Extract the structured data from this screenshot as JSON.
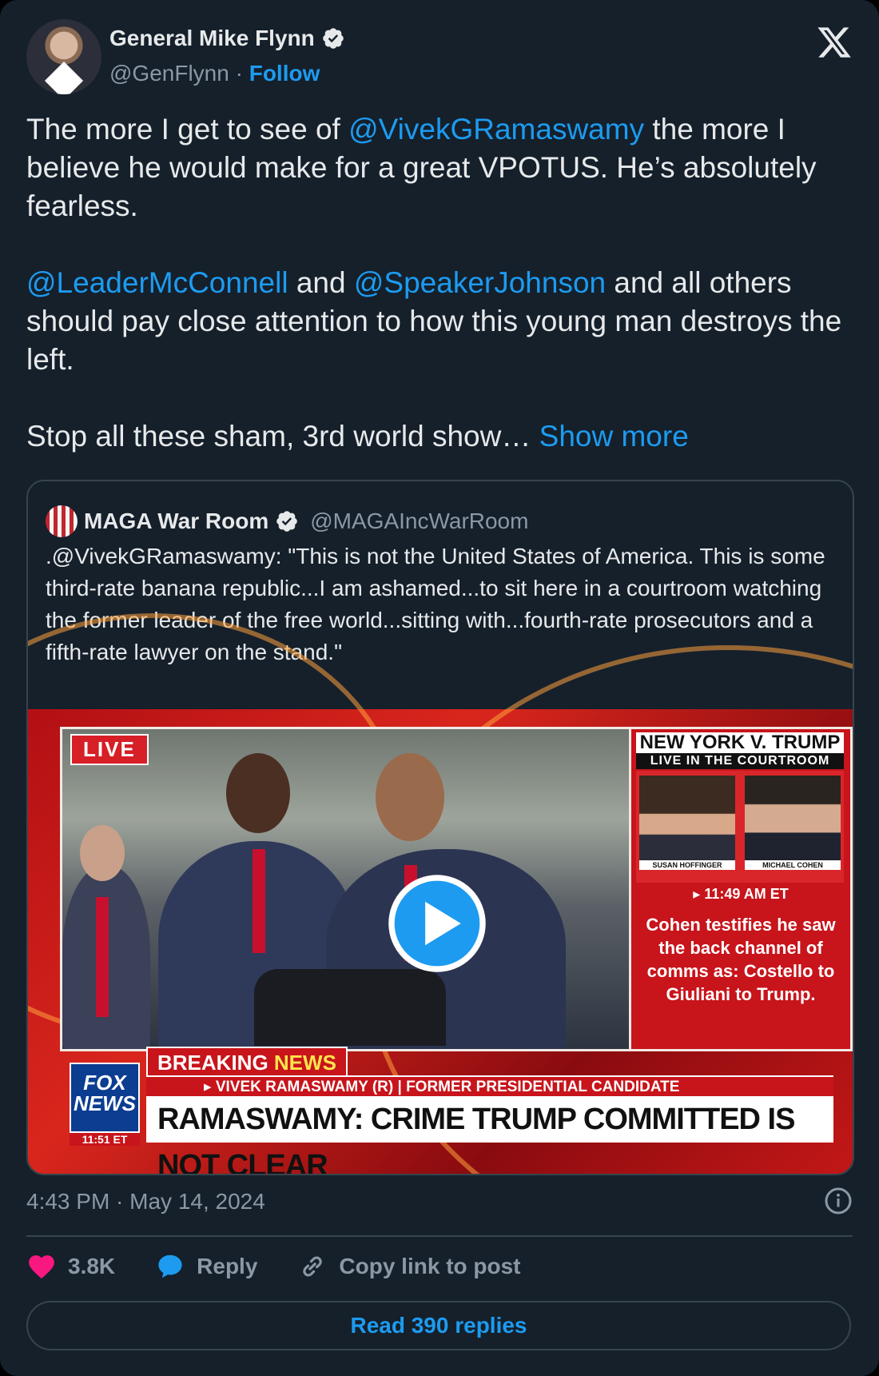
{
  "author": {
    "display_name": "General Mike Flynn",
    "handle": "@GenFlynn",
    "separator": "·",
    "follow_label": "Follow"
  },
  "tweet": {
    "part1": "The more I get to see of ",
    "mention1": "@VivekGRamaswamy",
    "part2": " the more I believe he would make for a great VPOTUS. He’s absolutely fearless.\n\n",
    "mention2": "@LeaderMcConnell",
    "part3": " and ",
    "mention3": "@SpeakerJohnson",
    "part4": " and all others should pay close attention to how this young man destroys the left.\n\nStop all these sham, 3rd world show… ",
    "show_more": "Show more"
  },
  "quote": {
    "display_name": "MAGA War Room",
    "handle": "@MAGAIncWarRoom",
    "text": ".@VivekGRamaswamy: \"This is not the United States of America. This is some third-rate banana republic...I am ashamed...to sit here in a courtroom watching the former leader of the free world...sitting with...fourth-rate prosecutors and a fifth-rate lawyer on the stand.\""
  },
  "video": {
    "live_tag": "LIVE",
    "side_title": "NEW YORK V. TRUMP",
    "side_subtitle": "LIVE IN THE COURTROOM",
    "pic1_label": "SUSAN HOFFINGER",
    "pic2_label": "MICHAEL COHEN",
    "side_time": "▸ 11:49 AM ET",
    "side_desc": "Cohen testifies he saw the back channel of comms as: Costello to Giuliani to Trump.",
    "breaking_word": "BREAKING",
    "news_word": "NEWS",
    "lower_sub": "▸ VIVEK RAMASWAMY (R) | FORMER PRESIDENTIAL CANDIDATE",
    "lower_main": "RAMASWAMY: CRIME TRUMP COMMITTED IS NOT CLEAR",
    "fox_line1": "FOX",
    "fox_line2": "NEWS",
    "fox_time": "11:51 ET"
  },
  "meta": {
    "timestamp": "4:43 PM · May 14, 2024"
  },
  "actions": {
    "likes": "3.8K",
    "reply_label": "Reply",
    "copy_label": "Copy link to post",
    "read_replies": "Read 390 replies"
  },
  "colors": {
    "background": "#15202b",
    "accent": "#1d9bf0",
    "like": "#f91880",
    "muted": "#8b98a5"
  }
}
